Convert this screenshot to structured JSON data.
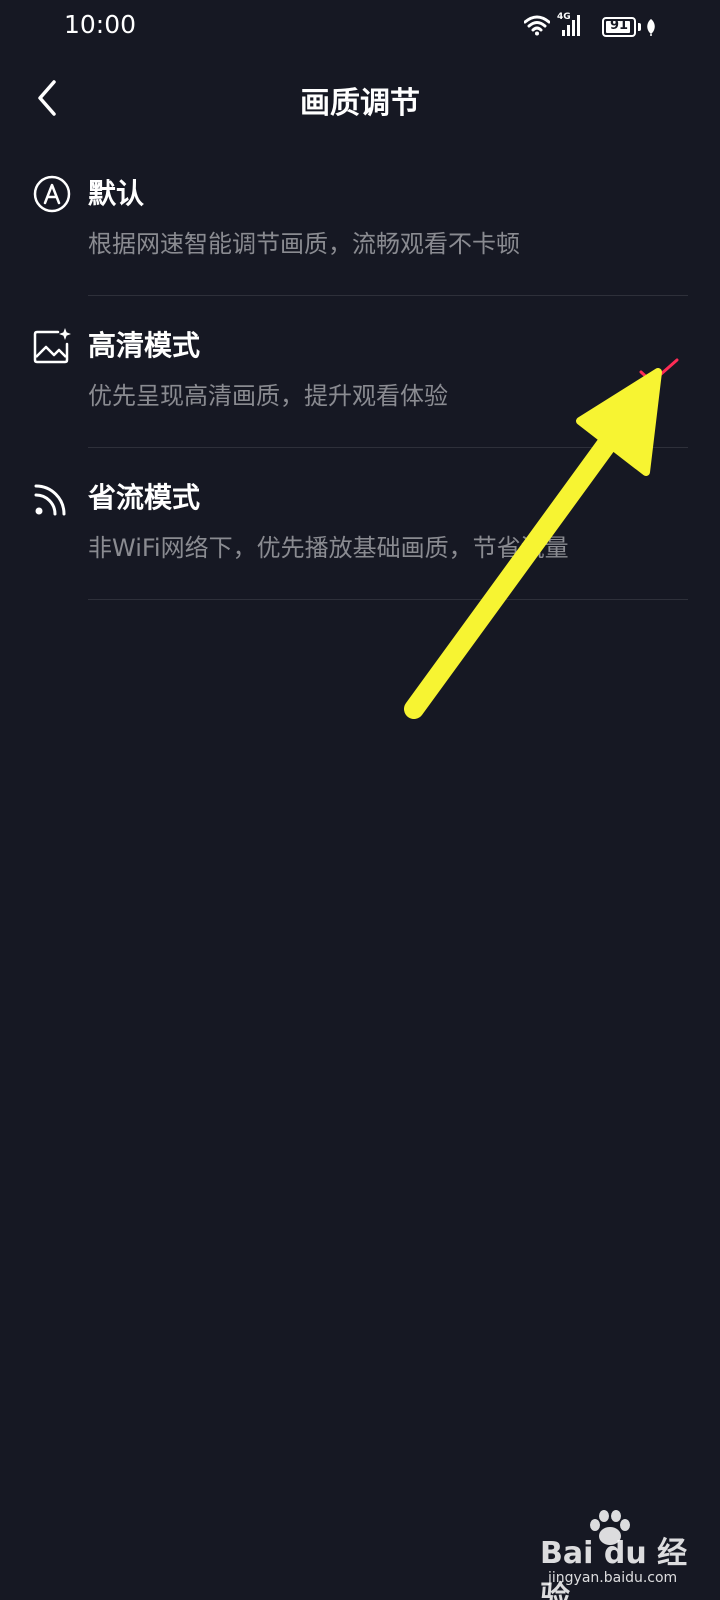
{
  "status_bar": {
    "time": "10:00",
    "network": "4G",
    "battery": "91",
    "battery_level": 0.91,
    "icons": [
      "wifi-icon",
      "signal-icon",
      "battery-icon",
      "leaf-icon"
    ]
  },
  "header": {
    "title": "画质调节",
    "back_icon": "chevron-left-icon"
  },
  "options": [
    {
      "icon": "auto-a-circle-icon",
      "title": "默认",
      "description": "根据网速智能调节画质，流畅观看不卡顿",
      "selected": false
    },
    {
      "icon": "image-sparkle-icon",
      "title": "高清模式",
      "description": "优先呈现高清画质，提升观看体验",
      "selected": true
    },
    {
      "icon": "signal-waves-icon",
      "title": "省流模式",
      "description": "非WiFi网络下，优先播放基础画质，节省流量",
      "selected": false
    }
  ],
  "colors": {
    "background": "#161823",
    "check_accent": "#fe2c55",
    "annotation_arrow": "#f7f432",
    "secondary_text": "#8a8b91"
  },
  "watermark": {
    "brand": "Bai du 经验",
    "url": "jingyan.baidu.com"
  }
}
